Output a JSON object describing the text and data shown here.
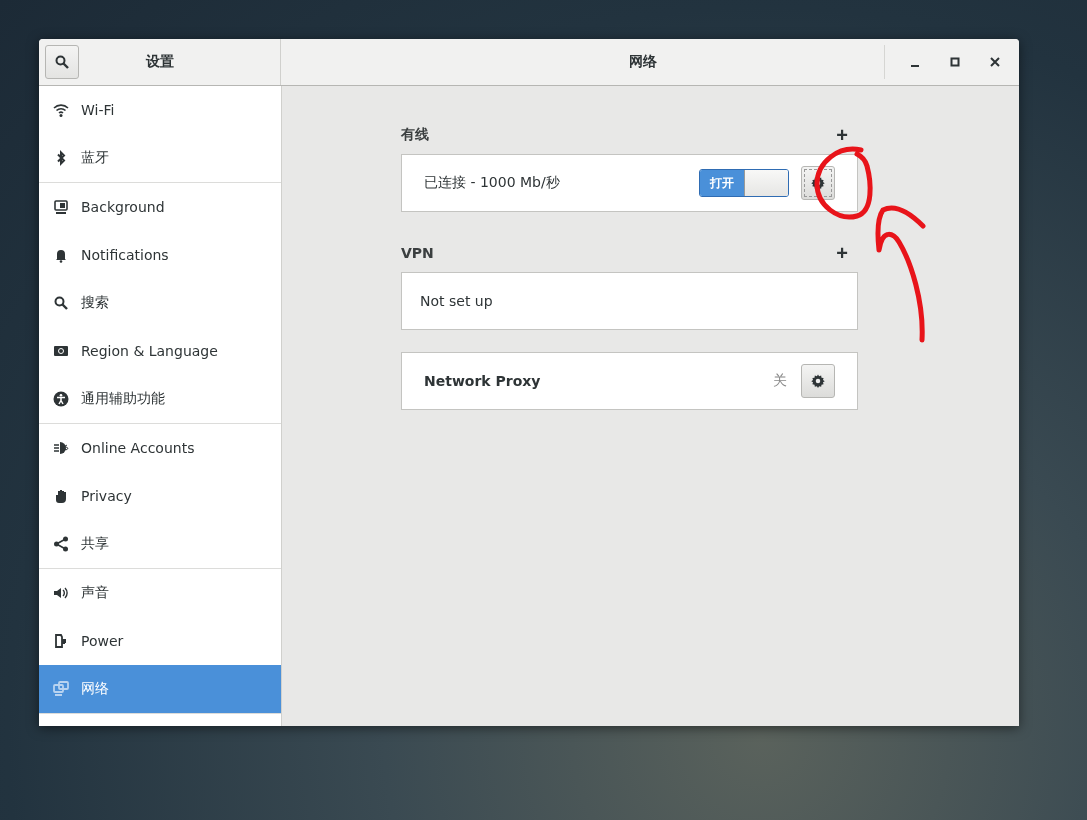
{
  "window": {
    "sidebar_title": "设置",
    "title": "网络"
  },
  "sidebar": {
    "groups": [
      [
        {
          "label": "Wi-Fi",
          "selected": false
        },
        {
          "label": "蓝牙",
          "selected": false
        }
      ],
      [
        {
          "label": "Background",
          "selected": false
        },
        {
          "label": "Notifications",
          "selected": false
        },
        {
          "label": "搜索",
          "selected": false
        },
        {
          "label": "Region & Language",
          "selected": false
        },
        {
          "label": "通用辅助功能",
          "selected": false
        }
      ],
      [
        {
          "label": "Online Accounts",
          "selected": false
        },
        {
          "label": "Privacy",
          "selected": false
        },
        {
          "label": "共享",
          "selected": false
        }
      ],
      [
        {
          "label": "声音",
          "selected": false
        },
        {
          "label": "Power",
          "selected": false
        },
        {
          "label": "网络",
          "selected": true
        }
      ]
    ]
  },
  "sections": [
    {
      "kind": "wired",
      "heading": "有线",
      "add": "+",
      "status": "已连接 - 1000 Mb/秒",
      "switch": {
        "on": true,
        "label": "打开"
      }
    },
    {
      "kind": "vpn",
      "heading": "VPN",
      "add": "+",
      "status": "Not set up"
    },
    {
      "kind": "proxy",
      "name": "Network Proxy",
      "state": "关"
    }
  ]
}
